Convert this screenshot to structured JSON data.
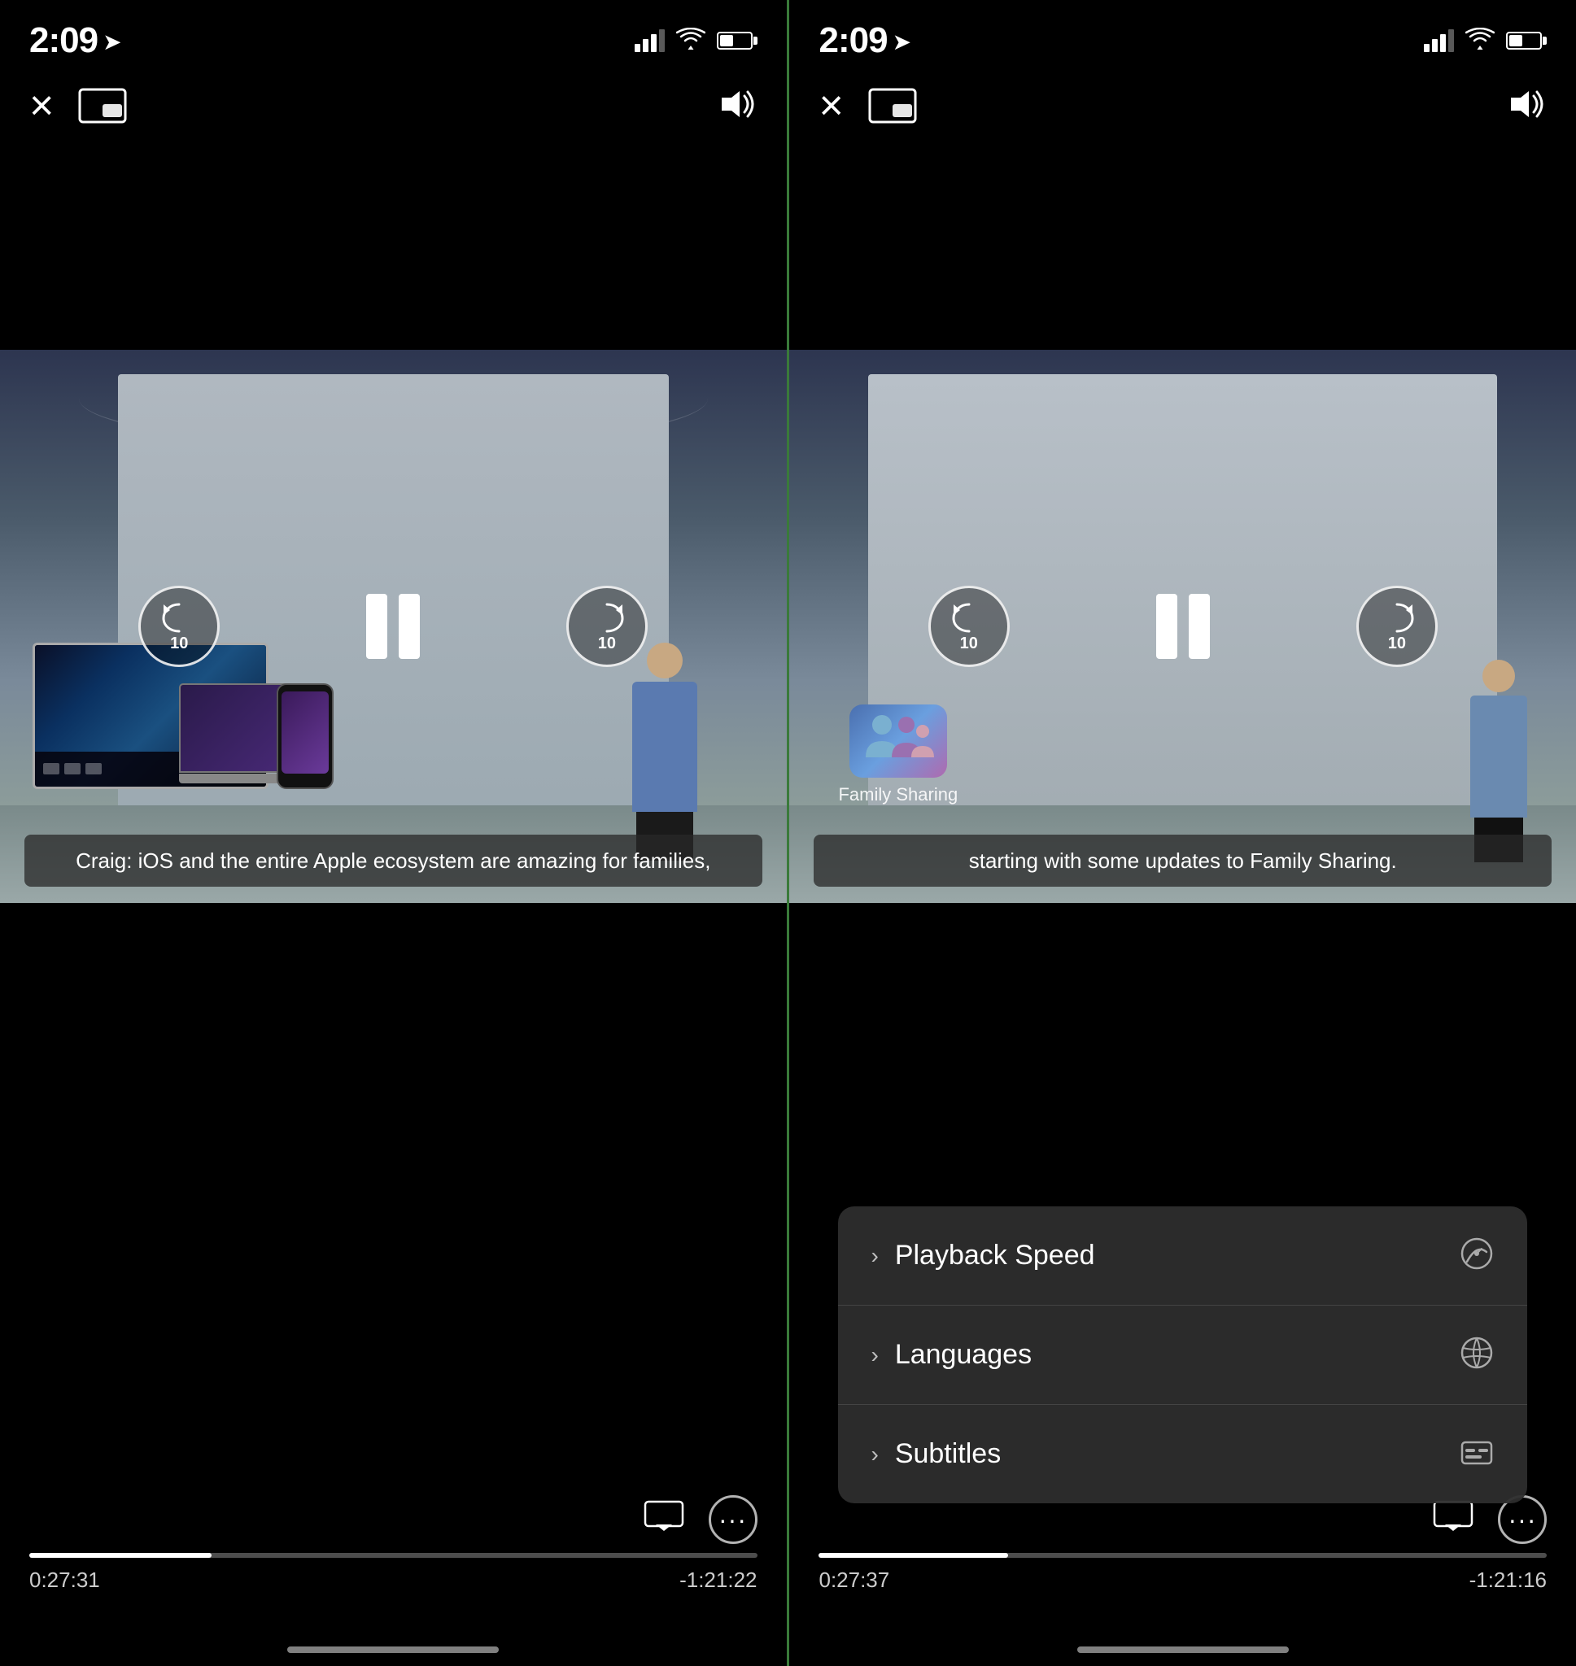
{
  "left": {
    "status": {
      "time": "2:09",
      "location_arrow": "▲"
    },
    "controls": {
      "close_label": "×",
      "volume_label": "🔊",
      "pip_label": "PiP"
    },
    "playback": {
      "rewind_seconds": "10",
      "forward_seconds": "10"
    },
    "subtitle": "Craig: iOS and the entire Apple ecosystem\nare amazing for families,",
    "progress": {
      "current_time": "0:27:31",
      "remaining_time": "-1:21:22",
      "fill_percent": "25"
    },
    "bottom_buttons": {
      "airplay": "⬜",
      "more": "···"
    }
  },
  "right": {
    "status": {
      "time": "2:09",
      "location_arrow": "▲"
    },
    "controls": {
      "close_label": "×",
      "volume_label": "🔊",
      "pip_label": "PiP"
    },
    "playback": {
      "rewind_seconds": "10",
      "forward_seconds": "10"
    },
    "subtitle": "starting with some updates\nto Family Sharing.",
    "progress": {
      "current_time": "0:27:37",
      "remaining_time": "-1:21:16",
      "fill_percent": "26"
    },
    "bottom_buttons": {
      "airplay": "⬜",
      "more": "···"
    },
    "menu": {
      "items": [
        {
          "id": "playback-speed",
          "label": "Playback Speed",
          "icon": "speedometer-icon"
        },
        {
          "id": "languages",
          "label": "Languages",
          "icon": "globe-icon"
        },
        {
          "id": "subtitles",
          "label": "Subtitles",
          "icon": "subtitles-icon"
        }
      ]
    }
  }
}
